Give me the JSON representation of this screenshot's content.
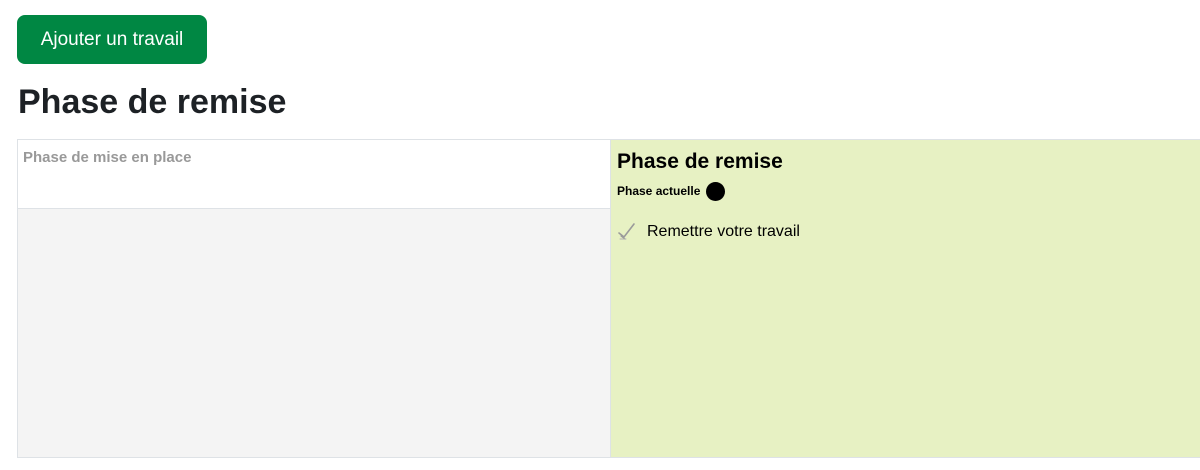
{
  "toolbar": {
    "add_button_label": "Ajouter un travail"
  },
  "page": {
    "title": "Phase de remise"
  },
  "phases": {
    "setup": {
      "title": "Phase de mise en place"
    },
    "submission": {
      "title": "Phase de remise",
      "current_label": "Phase actuelle",
      "tasks": [
        {
          "label": "Remettre votre travail",
          "icon": "checkmark-icon"
        }
      ]
    }
  },
  "colors": {
    "accent": "#008743",
    "current_phase_bg": "#e7f1c3",
    "inactive_phase_bg": "#f4f4f4",
    "inactive_title": "#999999"
  }
}
